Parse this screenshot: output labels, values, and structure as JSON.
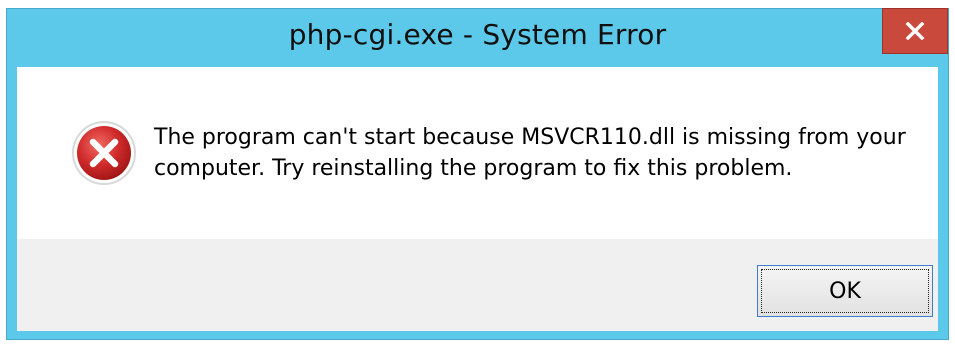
{
  "window": {
    "title": "php-cgi.exe - System Error",
    "close_icon": "close-icon"
  },
  "dialog": {
    "icon": "error-icon",
    "message_line1": "The program can't start because MSVCR110.dll is missing from your",
    "message_line2": "computer. Try reinstalling the program to fix this problem."
  },
  "buttons": {
    "ok_label": "OK"
  },
  "colors": {
    "titlebar": "#5cc9ea",
    "close_button": "#c9493c",
    "error_red": "#c0232b",
    "footer": "#f0f0f0"
  }
}
